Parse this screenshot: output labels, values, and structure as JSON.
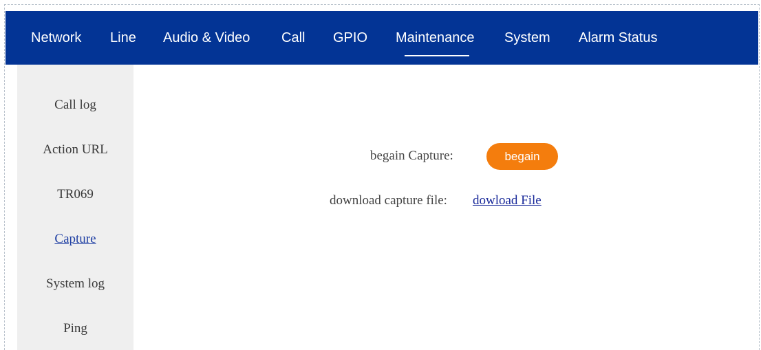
{
  "nav": {
    "items": [
      {
        "label": "Network"
      },
      {
        "label": "Line"
      },
      {
        "label": "Audio & Video"
      },
      {
        "label": "Call"
      },
      {
        "label": "GPIO"
      },
      {
        "label": "Maintenance"
      },
      {
        "label": "System"
      },
      {
        "label": "Alarm Status"
      }
    ],
    "active": "Maintenance",
    "bg_color": "#033495"
  },
  "sidebar": {
    "items": [
      {
        "label": "Call log"
      },
      {
        "label": "Action URL"
      },
      {
        "label": "TR069"
      },
      {
        "label": "Capture"
      },
      {
        "label": "System log"
      },
      {
        "label": "Ping"
      }
    ],
    "active": "Capture"
  },
  "capture": {
    "begin_label": "begain Capture:",
    "begin_button": "begain",
    "download_label": "download capture file:",
    "download_link": "dowload File",
    "button_color": "#f47d0d"
  }
}
